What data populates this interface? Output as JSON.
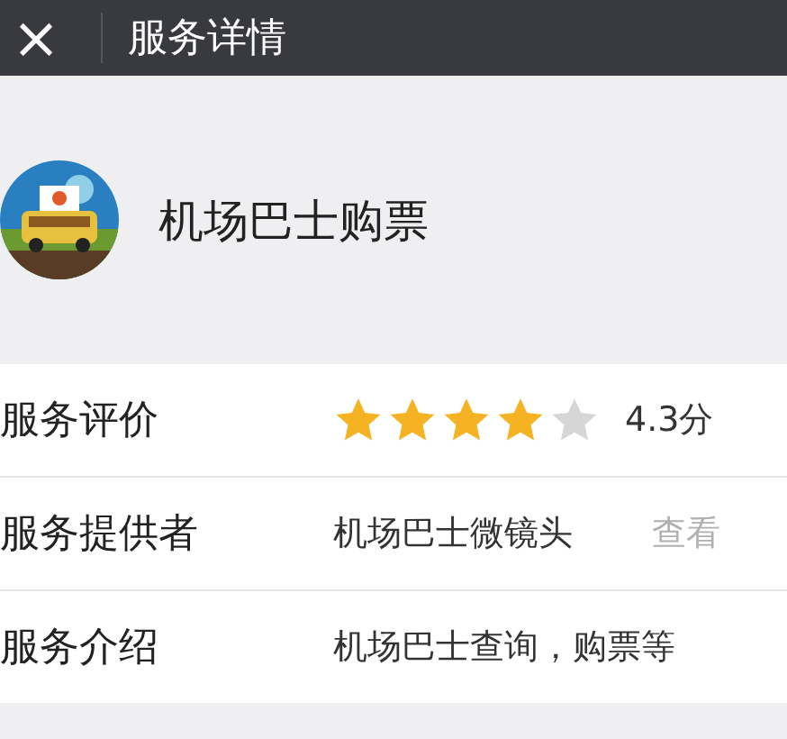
{
  "header": {
    "close": "×",
    "title": "服务详情"
  },
  "app": {
    "name": "机场巴士购票"
  },
  "rows": [
    {
      "kind": "rating",
      "label": "服务评价",
      "stars": 4,
      "value": "4.3分"
    },
    {
      "kind": "provider",
      "label": "服务提供者",
      "value": "机场巴士微镜头",
      "link": "查看"
    },
    {
      "kind": "text",
      "label": "服务介绍",
      "value": "机场巴士查询，购票等"
    }
  ]
}
